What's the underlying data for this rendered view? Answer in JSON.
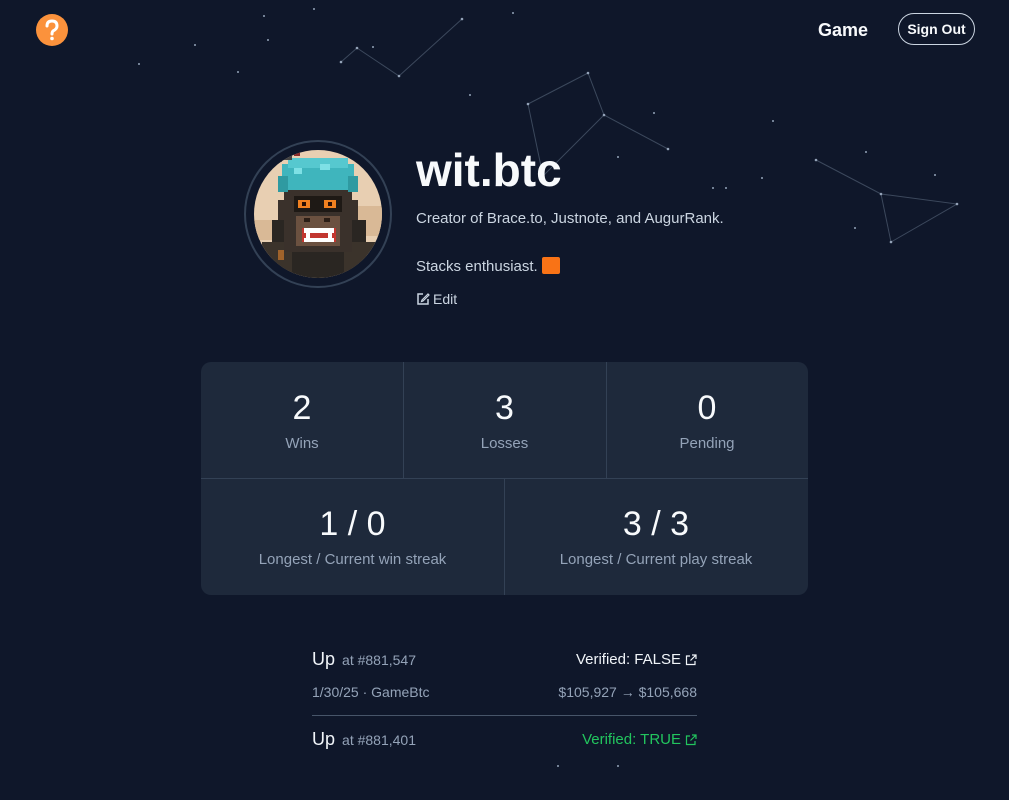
{
  "header": {
    "logo_icon": "question-mark-icon",
    "logo_color": "#fb923c",
    "nav_game": "Game",
    "sign_out": "Sign Out"
  },
  "profile": {
    "avatar_icon": "pixel-ape-avatar",
    "username": "wit.btc",
    "bio_line1": "Creator of Brace.to, Justnote, and AugurRank.",
    "bio_line2": "Stacks enthusiast.",
    "bio_emoji": "orange-square-emoji",
    "edit_icon": "edit-icon",
    "edit_label": "Edit"
  },
  "stats": {
    "wins": {
      "value": "2",
      "label": "Wins"
    },
    "losses": {
      "value": "3",
      "label": "Losses"
    },
    "pending": {
      "value": "0",
      "label": "Pending"
    },
    "win_streak": {
      "value": "1 / 0",
      "label": "Longest / Current win streak"
    },
    "play_streak": {
      "value": "3 / 3",
      "label": "Longest / Current play streak"
    }
  },
  "history": [
    {
      "direction": "Up",
      "at": "at #881,547",
      "verified": "Verified: FALSE",
      "verified_color": "#f1f5f9",
      "date_game": "1/30/25 · GameBtc",
      "price_change": "$105,927 → $105,668"
    },
    {
      "direction": "Up",
      "at": "at #881,401",
      "verified": "Verified: TRUE",
      "verified_color": "#22c55e",
      "date_game": "",
      "price_change": ""
    }
  ],
  "colors": {
    "background": "#0f172a",
    "card": "#1e293b",
    "accent_orange": "#fb923c",
    "verified_true": "#22c55e"
  }
}
